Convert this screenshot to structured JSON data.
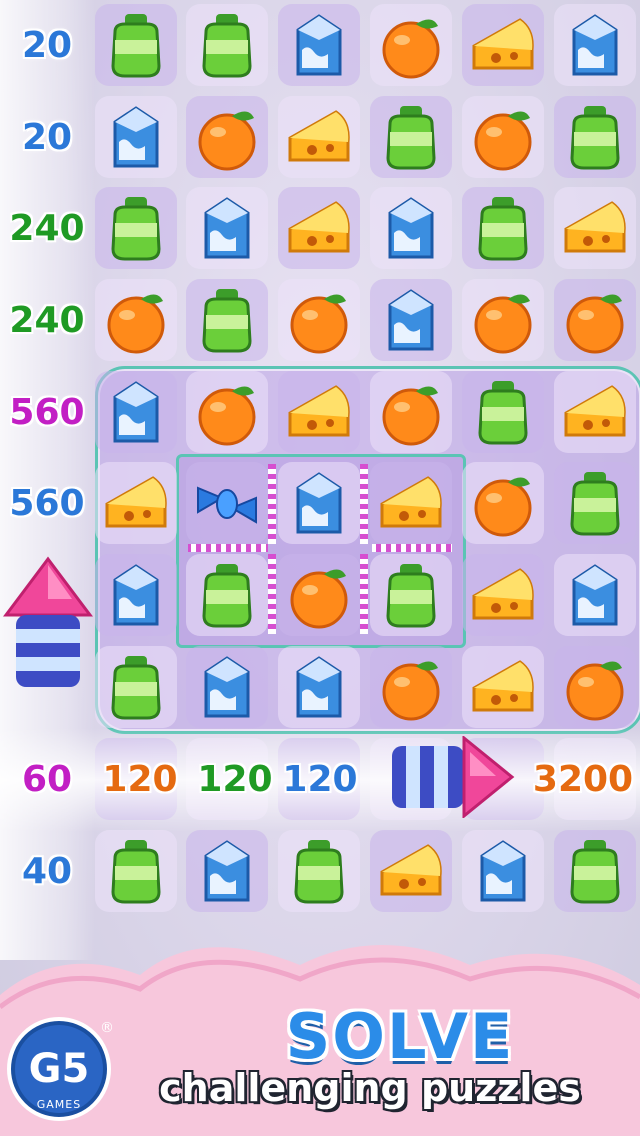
{
  "board": {
    "columns": 6,
    "rows": [
      {
        "score": "20",
        "score_color": "#2b78d8",
        "items": [
          "bottle",
          "bottle",
          "milk",
          "orange",
          "cheese",
          "milk"
        ]
      },
      {
        "score": "20",
        "score_color": "#2b78d8",
        "items": [
          "milk",
          "orange",
          "cheese",
          "bottle",
          "orange",
          "bottle"
        ]
      },
      {
        "score": "240",
        "score_color": "#1f9a24",
        "items": [
          "bottle",
          "milk",
          "cheese",
          "milk",
          "bottle",
          "cheese"
        ]
      },
      {
        "score": "240",
        "score_color": "#1f9a24",
        "items": [
          "orange",
          "bottle",
          "orange",
          "milk",
          "orange",
          "orange"
        ]
      },
      {
        "score": "560",
        "score_color": "#c21fc4",
        "items": [
          "milk",
          "orange",
          "cheese",
          "orange",
          "bottle",
          "cheese"
        ]
      },
      {
        "score": "560",
        "score_color": "#2b78d8",
        "items": [
          "cheese",
          "candy",
          "milk",
          "cheese",
          "orange",
          "bottle"
        ]
      },
      {
        "score": "",
        "score_color": "#2b78d8",
        "items": [
          "milk",
          "bottle",
          "orange",
          "bottle",
          "cheese",
          "milk"
        ]
      },
      {
        "score": "",
        "score_color": "#2b78d8",
        "items": [
          "bottle",
          "milk",
          "milk",
          "orange",
          "cheese",
          "orange"
        ]
      },
      {
        "score": "60",
        "score_color": "#c21fc4",
        "items": [
          "",
          "",
          "",
          "",
          "",
          ""
        ]
      },
      {
        "score": "40",
        "score_color": "#2b78d8",
        "items": [
          "bottle",
          "milk",
          "bottle",
          "cheese",
          "milk",
          "bottle"
        ]
      }
    ],
    "combo_row_scores": [
      {
        "value": "120",
        "color": "#e56a10"
      },
      {
        "value": "120",
        "color": "#1f9a24"
      },
      {
        "value": "120",
        "color": "#2b78d8"
      },
      {
        "value": "3200",
        "color": "#e56a10"
      }
    ]
  },
  "promo": {
    "title": "SOLVE",
    "subtitle": "challenging puzzles",
    "logo_text": "G5",
    "logo_sub": "GAMES",
    "logo_reg": "®"
  },
  "colors": {
    "accent": "#2b8ce8",
    "cloud": "#f7c7dc",
    "region_border": "#5bc4b4"
  }
}
